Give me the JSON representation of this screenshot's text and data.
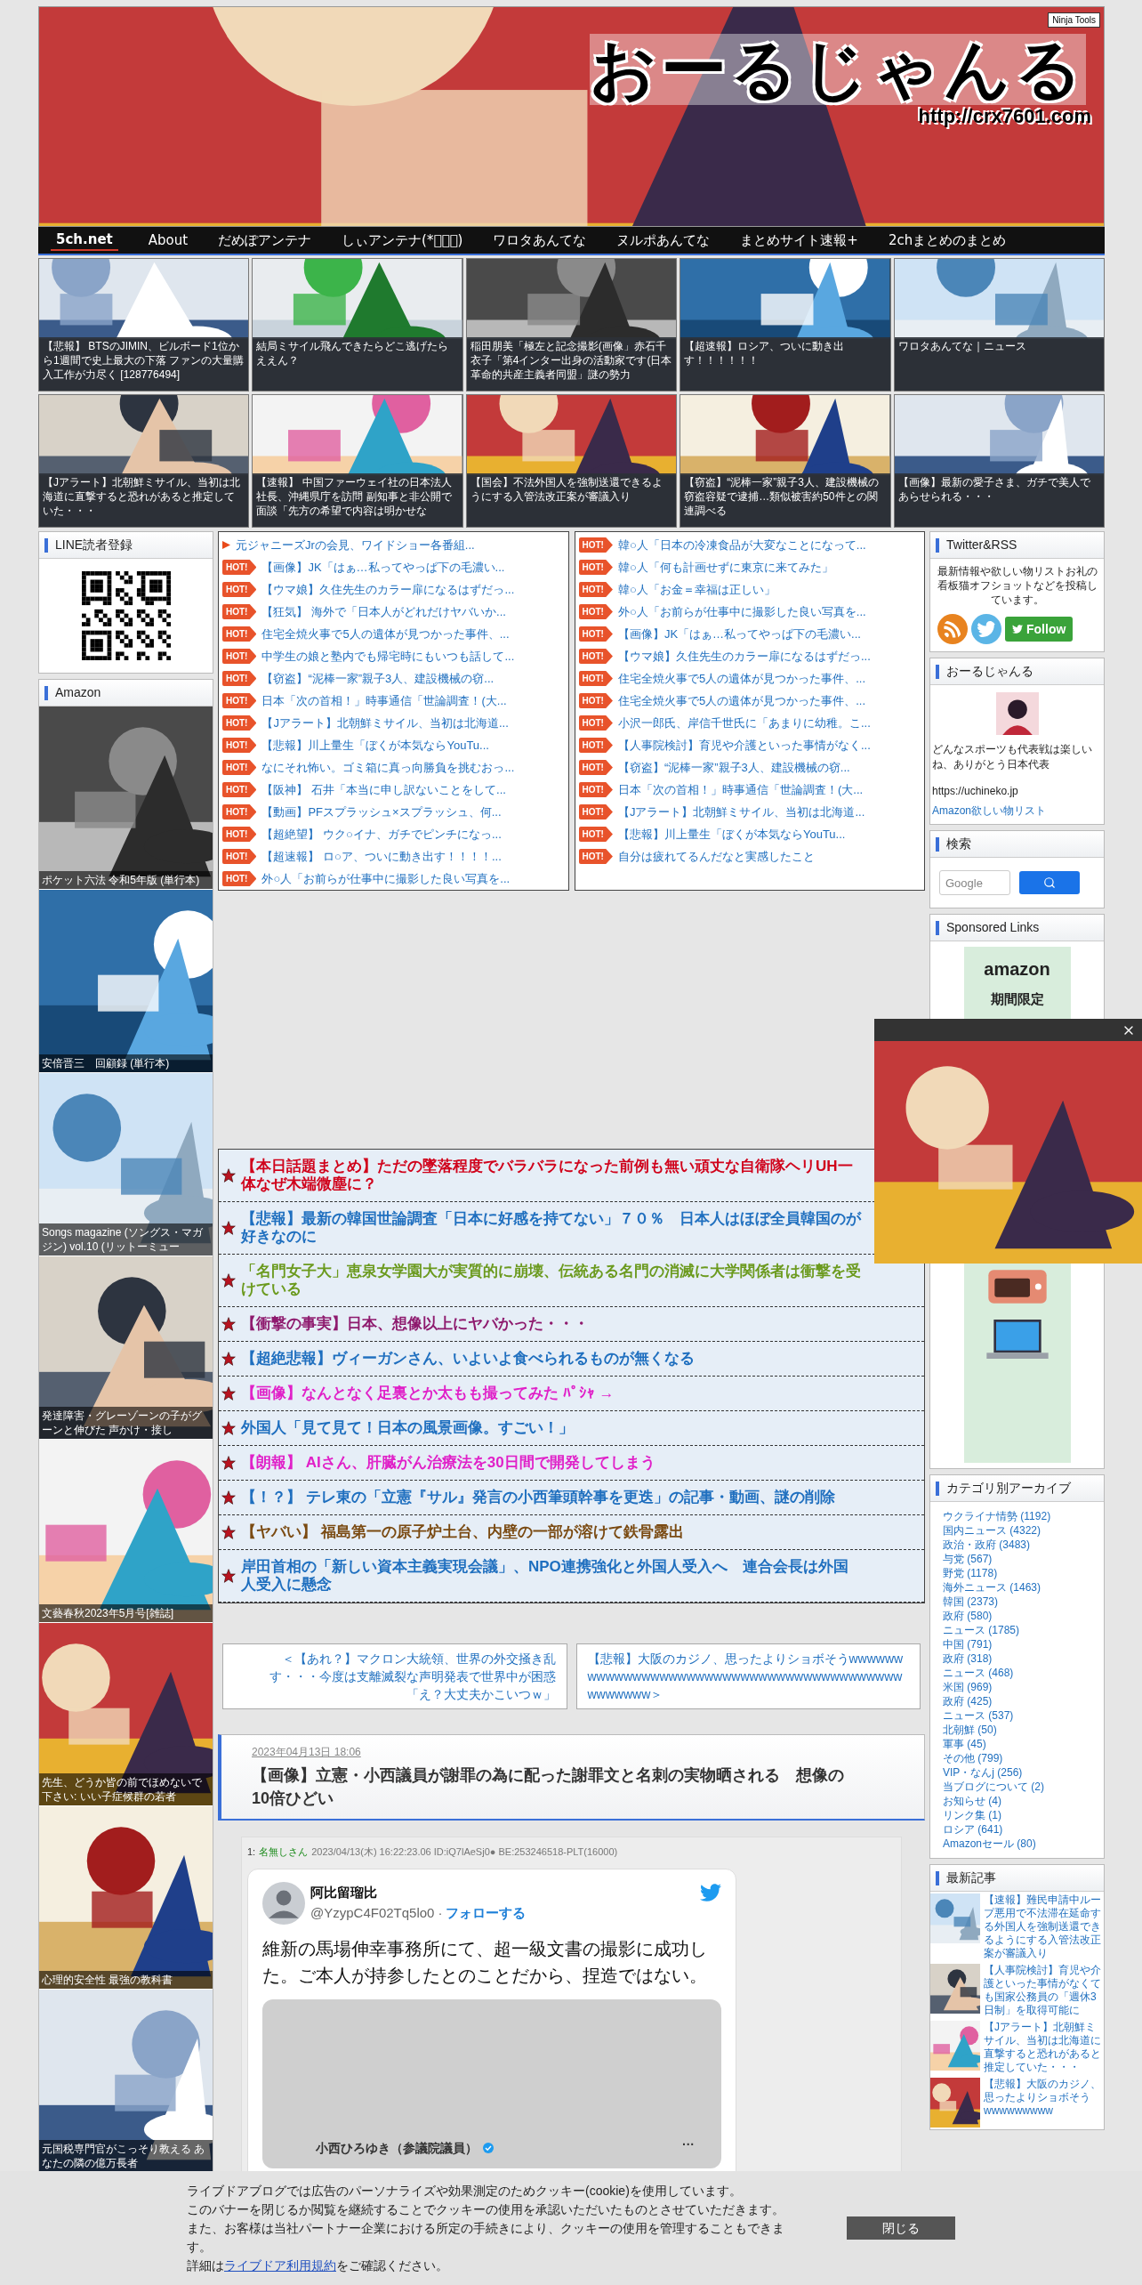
{
  "header": {
    "title": "おーるじゃんる",
    "url": "http://crx7601.com",
    "badge": "Ninja Tools"
  },
  "nav": [
    {
      "label": "5ch.net",
      "selected": true
    },
    {
      "label": "About",
      "selected": false
    },
    {
      "label": "だめぽアンテナ",
      "selected": false
    },
    {
      "label": "しぃアンテナ(*ﾟーﾟ)",
      "selected": false
    },
    {
      "label": "ワロタあんてな",
      "selected": false
    },
    {
      "label": "ヌルポあんてな",
      "selected": false
    },
    {
      "label": "まとめサイト速報+",
      "selected": false
    },
    {
      "label": "2chまとめのまとめ",
      "selected": false
    }
  ],
  "thumbnails": [
    {
      "caption": "【悲報】 BTSのJIMIN、ビルボード1位から1週間で史上最大の下落 ファンの大量購入工作が力尽く [128776494]"
    },
    {
      "caption": "結局ミサイル飛んできたらどこ逃げたらええん？"
    },
    {
      "caption": "稲田朋美「極左と記念撮影(画像」赤石千衣子「第4インター出身の活動家です(日本革命的共産主義者同盟」謎の勢力"
    },
    {
      "caption": "【超速報】ロシア、ついに動き出す！！！！！！"
    },
    {
      "caption": "ワロタあんてな｜ニュース"
    },
    {
      "caption": "【Jアラート】北朝鮮ミサイル、当初は北海道に直撃すると恐れがあると推定していた・・・"
    },
    {
      "caption": "【速報】 中国ファーウェイ社の日本法人社長、沖縄県庁を訪問 副知事と非公開で面談「先方の希望で内容は明かせな"
    },
    {
      "caption": "【国会】不法外国人を強制送還できるようにする入管法改正案が審議入り"
    },
    {
      "caption": "【窃盗】“泥棒一家”親子3人、建設機械の窃盗容疑で逮捕…類似被害約50件との関連調べる"
    },
    {
      "caption": "【画像】最新の愛子さま、ガチで美人であらせられる・・・"
    }
  ],
  "left_sidebar": {
    "line_heading": "LINE読者登録",
    "amazon_heading": "Amazon",
    "books": [
      {
        "caption": "ポケット六法 令和5年版 (単行本)"
      },
      {
        "caption": "安倍晋三　回顧録 (単行本)"
      },
      {
        "caption": "Songs magazine (ソングス・マガジン) vol.10 (リットーミュー"
      },
      {
        "caption": "発達障害・グレーゾーンの子がグーンと伸びた 声かけ・接し"
      },
      {
        "caption": "文藝春秋2023年5月号[雑誌]"
      },
      {
        "caption": "先生、どうか皆の前でほめないで下さい: いい子症候群の若者"
      },
      {
        "caption": "心理的安全性 最強の教科書"
      },
      {
        "caption": "元国税専門官がこっそり教える あなたの隣の億万長者"
      }
    ]
  },
  "hot_lists": [
    [
      {
        "kind": "new",
        "title": "元ジャニーズJrの会見、ワイドショー各番組..."
      },
      {
        "kind": "hot",
        "badge": "HOT!",
        "title": "【画像】JK「はぁ…私ってやっぱ下の毛濃い..."
      },
      {
        "kind": "hot",
        "badge": "HOT!",
        "title": "【ウマ娘】久住先生のカラー扉になるはずだっ..."
      },
      {
        "kind": "hot",
        "badge": "HOT!",
        "title": "【狂気】 海外で「日本人がどれだけヤバいか..."
      },
      {
        "kind": "hot",
        "badge": "HOT!",
        "title": "住宅全焼火事で5人の遺体が見つかった事件、..."
      },
      {
        "kind": "hot",
        "badge": "HOT!",
        "title": "中学生の娘と塾内でも帰宅時にもいつも話して..."
      },
      {
        "kind": "hot",
        "badge": "HOT!",
        "title": "【窃盗】“泥棒一家”親子3人、建設機械の窃..."
      },
      {
        "kind": "hot",
        "badge": "HOT!",
        "title": "日本「次の首相！」時事通信「世論調査！(大..."
      },
      {
        "kind": "hot",
        "badge": "HOT!",
        "title": "【Jアラート】北朝鮮ミサイル、当初は北海道..."
      },
      {
        "kind": "hot",
        "badge": "HOT!",
        "title": "【悲報】川上量生「ぼくが本気ならYouTu..."
      },
      {
        "kind": "hot",
        "badge": "HOT!",
        "title": "なにそれ怖い。ゴミ箱に真っ向勝負を挑むおっ..."
      },
      {
        "kind": "hot",
        "badge": "HOT!",
        "title": "【阪神】 石井「本当に申し訳ないことをして..."
      },
      {
        "kind": "hot",
        "badge": "HOT!",
        "title": "【動画】PFスプラッシュ×スプラッシュ、何..."
      },
      {
        "kind": "hot",
        "badge": "HOT!",
        "title": "【超絶望】 ウク○イナ、ガチでピンチになっ..."
      },
      {
        "kind": "hot",
        "badge": "HOT!",
        "title": "【超速報】 ロ○ア、ついに動き出す！！！！..."
      },
      {
        "kind": "hot",
        "badge": "HOT!",
        "title": "外○人「お前らが仕事中に撮影した良い写真を..."
      }
    ],
    [
      {
        "kind": "hot",
        "badge": "HOT!",
        "title": "韓○人「日本の冷凍食品が大変なことになって..."
      },
      {
        "kind": "hot",
        "badge": "HOT!",
        "title": "韓○人「何も計画せずに東京に来てみた」"
      },
      {
        "kind": "hot",
        "badge": "HOT!",
        "title": "韓○人「お金＝幸福は正しい」"
      },
      {
        "kind": "hot",
        "badge": "HOT!",
        "title": "外○人「お前らが仕事中に撮影した良い写真を..."
      },
      {
        "kind": "hot",
        "badge": "HOT!",
        "title": "【画像】JK「はぁ…私ってやっぱ下の毛濃い..."
      },
      {
        "kind": "hot",
        "badge": "HOT!",
        "title": "【ウマ娘】久住先生のカラー扉になるはずだっ..."
      },
      {
        "kind": "hot",
        "badge": "HOT!",
        "title": "住宅全焼火事で5人の遺体が見つかった事件、..."
      },
      {
        "kind": "hot",
        "badge": "HOT!",
        "title": "住宅全焼火事で5人の遺体が見つかった事件、..."
      },
      {
        "kind": "hot",
        "badge": "HOT!",
        "title": "小沢一郎氏、岸信千世氏に「あまりに幼稚。こ..."
      },
      {
        "kind": "hot",
        "badge": "HOT!",
        "title": "【人事院検討】育児や介護といった事情がなく..."
      },
      {
        "kind": "hot",
        "badge": "HOT!",
        "title": "【窃盗】“泥棒一家”親子3人、建設機械の窃..."
      },
      {
        "kind": "hot",
        "badge": "HOT!",
        "title": "日本「次の首相！」時事通信「世論調査！(大..."
      },
      {
        "kind": "hot",
        "badge": "HOT!",
        "title": "【Jアラート】北朝鮮ミサイル、当初は北海道..."
      },
      {
        "kind": "hot",
        "badge": "HOT!",
        "title": "【悲報】川上量生「ぼくが本気ならYouTu..."
      },
      {
        "kind": "hot",
        "badge": "HOT!",
        "title": "自分は疲れてるんだなと実感したこと"
      }
    ]
  ],
  "headlines": [
    {
      "title": "【本日話題まとめ】ただの墜落程度でバラバラになった前例も無い頑丈な自衛隊ヘリUH一体なぜ木端微塵に？",
      "color": "#d0021b"
    },
    {
      "title": "【悲報】最新の韓国世論調査「日本に好感を持てない」７０％　日本人はほぼ全員韓国のが好きなのに",
      "color": "#1f6fbf"
    },
    {
      "title": "「名門女子大」恵泉女学園大が実質的に崩壊、伝統ある名門の消滅に大学関係者は衝撃を受けている",
      "color": "#6b9a1e"
    },
    {
      "title": "【衝撃の事実】日本、想像以上にヤバかった・・・",
      "color": "#8e1a6e"
    },
    {
      "title": "【超絶悲報】ヴィーガンさん、いよいよ食べられるものが無くなる",
      "color": "#1f6fbf"
    },
    {
      "title": "【画像】なんとなく足裏とか太もも撮ってみた ﾊﾟｼｬ →",
      "color": "#e020c8"
    },
    {
      "title": "外国人「見て見て！日本の風景画像。すごい！」",
      "color": "#1f6fbf"
    },
    {
      "title": "【朗報】 AIさん、肝臓がん治療法を30日間で開発してしまう",
      "color": "#e020c8"
    },
    {
      "title": "【！？】 テレ東の「立憲『サル』発言の小西筆頭幹事を更迭」の記事・動画、謎の削除",
      "color": "#1f6fbf"
    },
    {
      "title": "【ヤバい】 福島第一の原子炉土台、内壁の一部が溶けて鉄骨露出",
      "color": "#7a4a12"
    },
    {
      "title": "岸田首相の「新しい資本主義実現会議」、NPO連携強化と外国人受入へ　連合会長は外国人受入に懸念",
      "color": "#1f6fbf"
    }
  ],
  "pager": {
    "prev": "＜【あれ？】マクロン大統領、世界の外交掻き乱す・・・今度は支離滅裂な声明発表で世界中が困惑「え？大丈夫かこいつｗ」",
    "next": "【悲報】大阪のカジノ、思ったよりショボそうwwwwwwwwwwwwwwwwwwwwwwwwwwwwwwwwwwwwwwwwwwwwwwww＞"
  },
  "article": {
    "date": "2023年04月13日 18:06",
    "title": "【画像】立憲・小西議員が謝罪の為に配った謝罪文と名刺の実物晒される　想像の10倍ひどい",
    "post": {
      "number": "1:",
      "author": "名無しさん",
      "meta": "2023/04/13(木) 16:22:23.06 ID:iQ7lAeSj0● BE:253246518-PLT(16000)"
    },
    "tweet": {
      "name": "阿比留瑠比",
      "handle": "@YzypC4F02Tq5lo0",
      "separator": "·",
      "follow": "フォローする",
      "text": "維新の馬場伸幸事務所にて、超一級文書の撮影に成功した。ご本人が持参したとのことだから、捏造ではない。",
      "embedded_name": "小西ひろゆき（参議院議員）",
      "embedded_more": "···"
    }
  },
  "right_sidebar": {
    "twitter_heading": "Twitter&RSS",
    "twitter_text": "最新情報や欲しい物リストお礼の看板猫オフショットなどを投稿しています。",
    "follow": "Follow",
    "about_heading": "おーるじゃんる",
    "about_text": "どんなスポーツも代表戦は楽しいね、ありがとう日本代表",
    "about_url": "https://uchineko.jp",
    "about_link": "Amazon欲しい物リスト",
    "search_heading": "検索",
    "search_placeholder": "Google",
    "sponsored_heading": "Sponsored Links",
    "ad_brand": "amazon",
    "ad_label": "期間限定",
    "archive_heading": "カテゴリ別アーカイブ",
    "archive": [
      "ウクライナ情勢 (1192)",
      "国内ニュース (4322)",
      "政治・政府 (3483)",
      "与党 (567)",
      "野党 (1178)",
      "海外ニュース (1463)",
      "韓国 (2373)",
      "政府 (580)",
      "ニュース (1785)",
      "中国 (791)",
      "政府 (318)",
      "ニュース (468)",
      "米国 (969)",
      "政府 (425)",
      "ニュース (537)",
      "北朝鮮 (50)",
      "軍事 (45)",
      "その他 (799)",
      "VIP・なんj (256)",
      "当ブログについて (2)",
      "お知らせ (4)",
      "リンク集 (1)",
      "ロシア (641)",
      "Amazonセール (80)"
    ],
    "recent_heading": "最新記事",
    "recent": [
      "【速報】難民申請中ループ悪用で不法滞在延命する外国人を強制送還できるようにする入管法改正案が審議入り",
      "【人事院検討】育児や介護といった事情がなくても国家公務員の「週休3日制」を取得可能に",
      "【Jアラート】北朝鮮ミサイル、当初は北海道に直撃すると恐れがあると推定していた・・・",
      "【悲報】大阪のカジノ、思ったよりショボそうwwwwwwwww"
    ]
  },
  "cookie_banner": {
    "lines": [
      "ライブドアブログでは広告のパーソナライズや効果測定のためクッキー(cookie)を使用しています。",
      "このバナーを閉じるか閲覧を継続することでクッキーの使用を承認いただいたものとさせていただきます。",
      "また、お客様は当社パートナー企業における所定の手続きにより、クッキーの使用を管理することもできます。"
    ],
    "detail_prefix": "詳細は",
    "detail_link": "ライブドア利用規約",
    "detail_suffix": "をご確認ください。",
    "close": "閉じる"
  }
}
